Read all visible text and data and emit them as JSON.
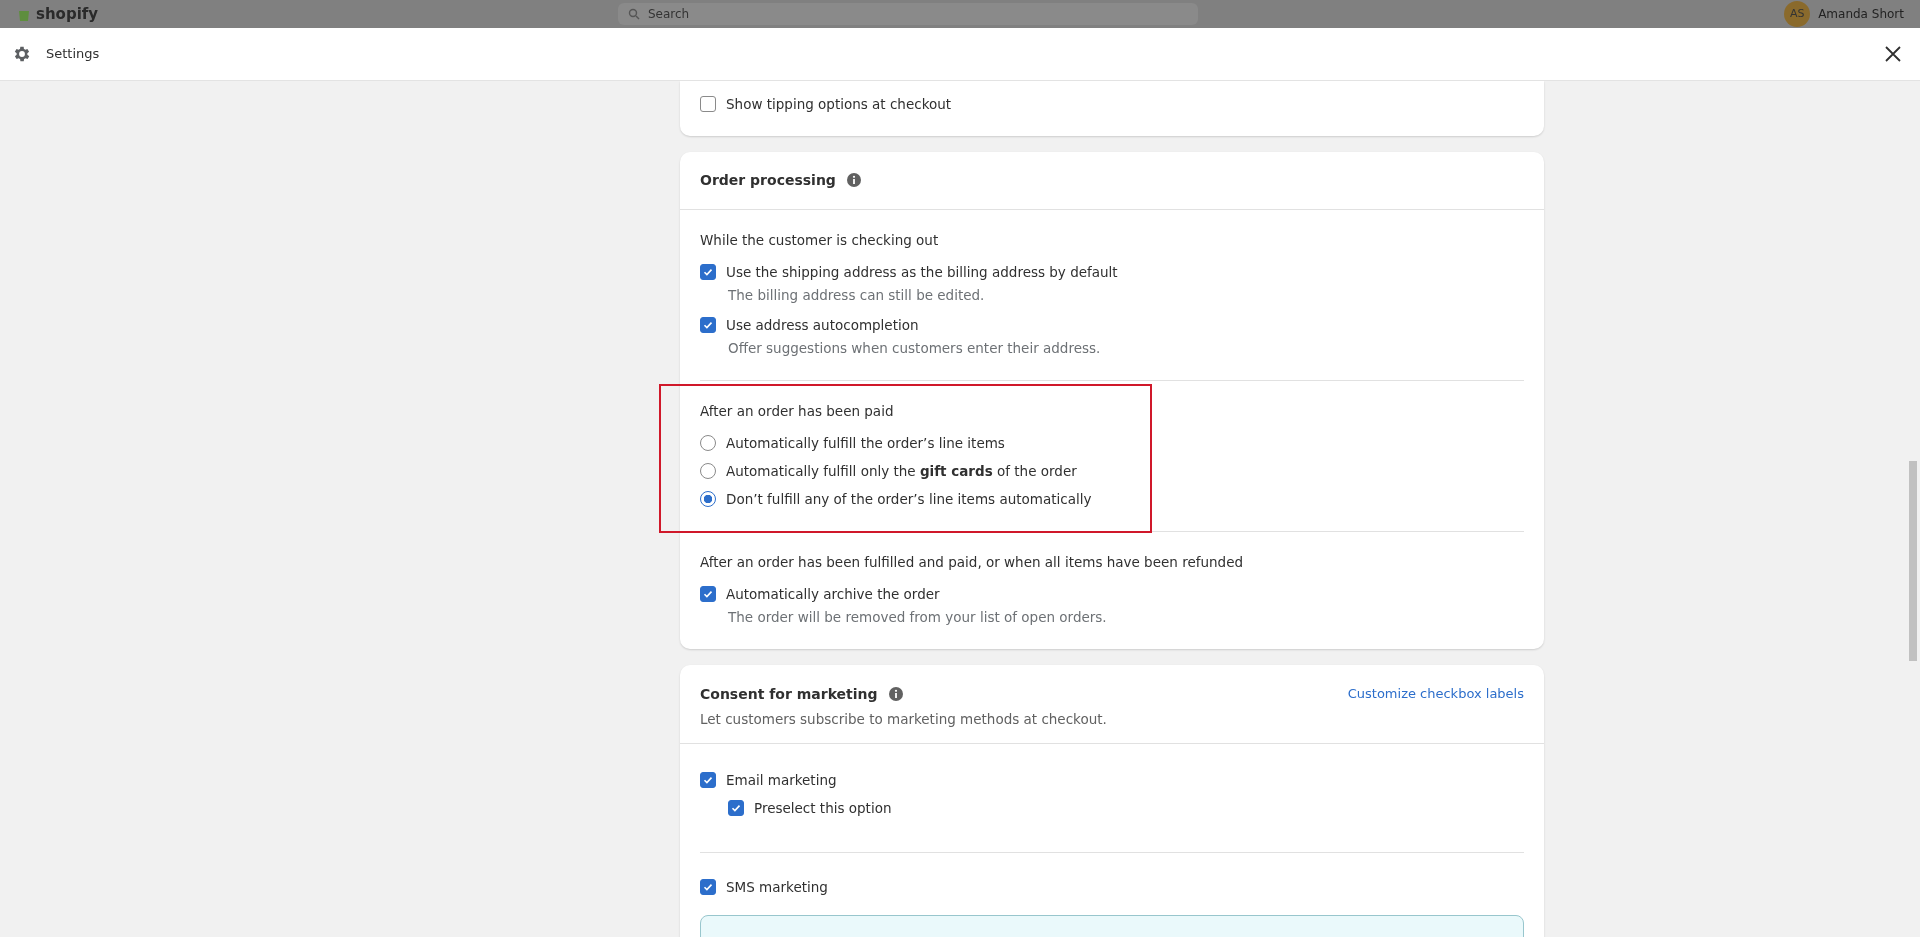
{
  "backdrop": {
    "logo": "shopify",
    "search": {
      "placeholder": "Search"
    },
    "user": {
      "initials": "AS",
      "name": "Amanda Short"
    }
  },
  "window": {
    "title": "Settings"
  },
  "tipping_card": {
    "items": [
      {
        "label": "Show tipping options at checkout",
        "checked": false
      }
    ]
  },
  "order_processing": {
    "title": "Order processing",
    "groups": [
      {
        "heading": "While the customer is checking out",
        "kind": "checkboxes",
        "highlighted": false,
        "items": [
          {
            "label": "Use the shipping address as the billing address by default",
            "help": "The billing address can still be edited.",
            "checked": true
          },
          {
            "label": "Use address autocompletion",
            "help": "Offer suggestions when customers enter their address.",
            "checked": true
          }
        ]
      },
      {
        "heading": "After an order has been paid",
        "kind": "radios",
        "highlighted": true,
        "items": [
          {
            "label": "Automatically fulfill the order’s line items",
            "selected": false
          },
          {
            "label": "Automatically fulfill only the **gift cards** of the order",
            "selected": false
          },
          {
            "label": "Don’t fulfill any of the order’s line items automatically",
            "selected": true
          }
        ]
      },
      {
        "heading": "After an order has been fulfilled and paid, or when all items have been refunded",
        "kind": "checkboxes",
        "highlighted": false,
        "items": [
          {
            "label": "Automatically archive the order",
            "help": "The order will be removed from your list of open orders.",
            "checked": true
          }
        ]
      }
    ]
  },
  "consent_card": {
    "title": "Consent for marketing",
    "link": "Customize checkbox labels",
    "subtitle": "Let customers subscribe to marketing methods at checkout.",
    "groups": [
      {
        "label": "Email marketing",
        "checked": true,
        "children": [
          {
            "label": "Preselect this option",
            "checked": true
          }
        ]
      },
      {
        "label": "SMS marketing",
        "checked": true
      }
    ]
  }
}
